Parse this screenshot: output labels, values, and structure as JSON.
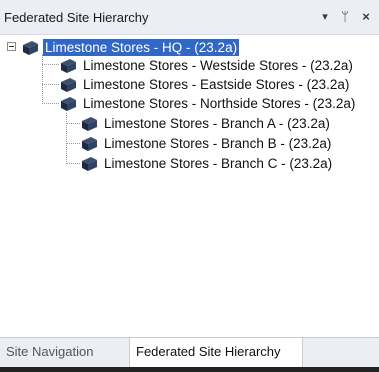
{
  "panel": {
    "title": "Federated Site Hierarchy",
    "controls": {
      "dropdown_glyph": "▾",
      "pin_glyph": "ᛘ",
      "close_glyph": "×"
    }
  },
  "tree": {
    "root": {
      "label": "Limestone Stores - HQ - (23.2a)",
      "expanded": true,
      "selected": true
    },
    "children": [
      {
        "label": "Limestone Stores - Westside Stores - (23.2a)"
      },
      {
        "label": "Limestone Stores - Eastside Stores - (23.2a)"
      },
      {
        "label": "Limestone Stores - Northside Stores - (23.2a)"
      },
      {
        "label": "Limestone Stores - Branch A - (23.2a)"
      },
      {
        "label": "Limestone Stores - Branch B - (23.2a)"
      },
      {
        "label": "Limestone Stores - Branch C - (23.2a)"
      }
    ]
  },
  "tabs": [
    {
      "label": "Site Navigation",
      "active": false
    },
    {
      "label": "Federated Site Hierarchy",
      "active": true
    }
  ],
  "colors": {
    "selection": "#3167c7",
    "chrome": "#ebeef4"
  },
  "icons": {
    "site": "site-server-icon",
    "expander": "collapse-minus-icon"
  }
}
